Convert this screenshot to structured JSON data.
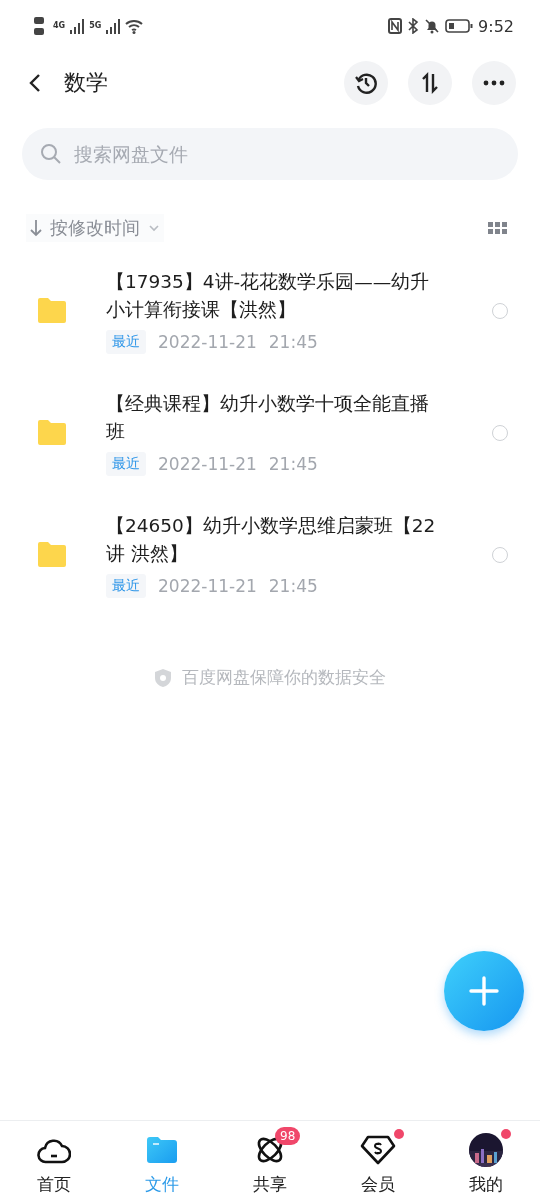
{
  "status_bar": {
    "network_1": "4G",
    "network_2": "5G",
    "time": "9:52"
  },
  "header": {
    "title": "数学"
  },
  "search": {
    "placeholder": "搜索网盘文件"
  },
  "sort": {
    "label": "按修改时间"
  },
  "files": [
    {
      "name": "【17935】4讲-花花数学乐园——幼升小计算衔接课【洪然】",
      "tag": "最近",
      "date": "2022-11-21",
      "time": "21:45",
      "selected": false
    },
    {
      "name": "【经典课程】幼升小数学十项全能直播班",
      "tag": "最近",
      "date": "2022-11-21",
      "time": "21:45",
      "selected": false
    },
    {
      "name": "【24650】幼升小数学思维启蒙班【22讲 洪然】",
      "tag": "最近",
      "date": "2022-11-21",
      "time": "21:45",
      "selected": false
    }
  ],
  "footer_note": "百度网盘保障你的数据安全",
  "tabs": [
    {
      "kind": "home",
      "label": "首页",
      "selected": false
    },
    {
      "kind": "files",
      "label": "文件",
      "selected": true
    },
    {
      "kind": "share",
      "label": "共享",
      "selected": false,
      "badge": "98"
    },
    {
      "kind": "member",
      "label": "会员",
      "selected": false,
      "dot": true
    },
    {
      "kind": "me",
      "label": "我的",
      "selected": false,
      "dot": true
    }
  ]
}
